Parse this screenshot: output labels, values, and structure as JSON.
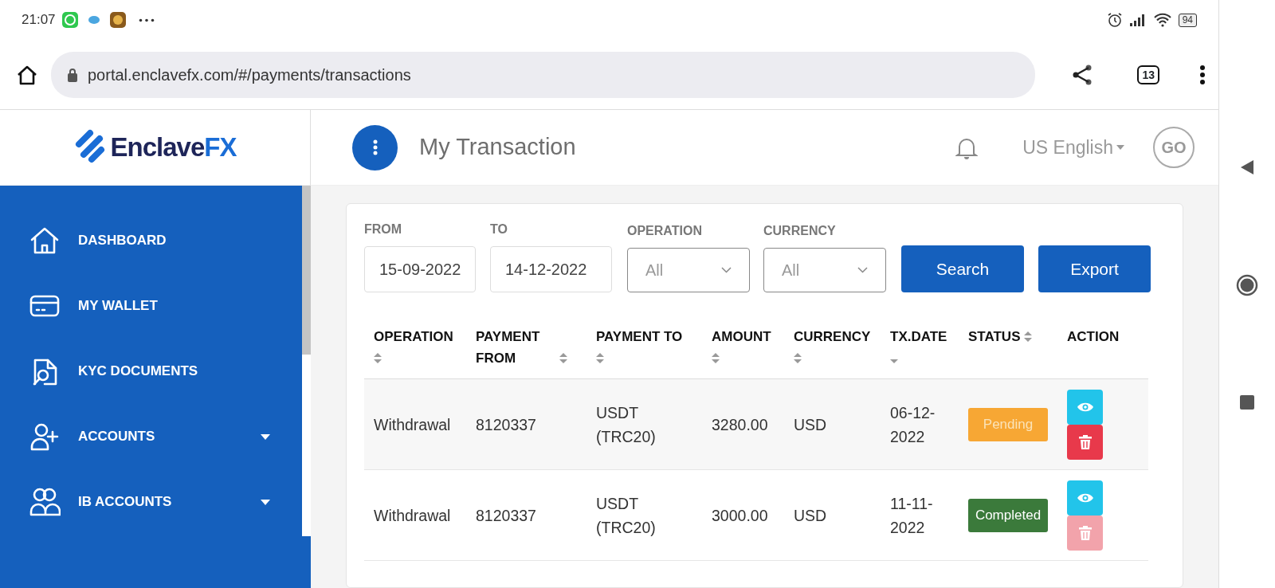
{
  "status_bar": {
    "time": "21:07",
    "battery": "94"
  },
  "browser": {
    "url": "portal.enclavefx.com/#/payments/transactions",
    "tab_count": "13"
  },
  "logo": {
    "text": "Enclave",
    "accent": "FX"
  },
  "header": {
    "title": "My Transaction",
    "language": "US English",
    "avatar": "GO"
  },
  "sidebar": {
    "items": [
      {
        "label": "DASHBOARD",
        "expandable": false
      },
      {
        "label": "MY WALLET",
        "expandable": false
      },
      {
        "label": "KYC DOCUMENTS",
        "expandable": false
      },
      {
        "label": "ACCOUNTS",
        "expandable": true
      },
      {
        "label": "IB ACCOUNTS",
        "expandable": true
      }
    ]
  },
  "filters": {
    "from_label": "FROM",
    "from": "15-09-2022",
    "to_label": "TO",
    "to": "14-12-2022",
    "operation_label": "OPERATION",
    "operation": "All",
    "currency_label": "CURRENCY",
    "currency": "All",
    "buttons": [
      "Search",
      "Export"
    ]
  },
  "table": {
    "columns": [
      {
        "label": "OPERATION",
        "sortable": true,
        "sorted": false
      },
      {
        "label": "PAYMENT FROM",
        "sortable": true,
        "sorted": false
      },
      {
        "label": "PAYMENT TO",
        "sortable": true,
        "sorted": false
      },
      {
        "label": "AMOUNT",
        "sortable": true,
        "sorted": false
      },
      {
        "label": "CURRENCY",
        "sortable": true,
        "sorted": false
      },
      {
        "label": "TX.DATE",
        "sortable": true,
        "sorted": true
      },
      {
        "label": "STATUS",
        "sortable": true,
        "sorted": false
      },
      {
        "label": "ACTION",
        "sortable": false
      }
    ],
    "rows": [
      {
        "operation": "Withdrawal",
        "payment_from": "8120337",
        "payment_to": "USDT (TRC20)",
        "amount": "3280.00",
        "currency": "USD",
        "tx_date": "06-12-2022",
        "status": {
          "kind": "pending",
          "label": "Pending"
        },
        "delete_disabled": false
      },
      {
        "operation": "Withdrawal",
        "payment_from": "8120337",
        "payment_to": "USDT (TRC20)",
        "amount": "3000.00",
        "currency": "USD",
        "tx_date": "11-11-2022",
        "status": {
          "kind": "completed",
          "label": "Completed"
        },
        "delete_disabled": true
      }
    ]
  }
}
